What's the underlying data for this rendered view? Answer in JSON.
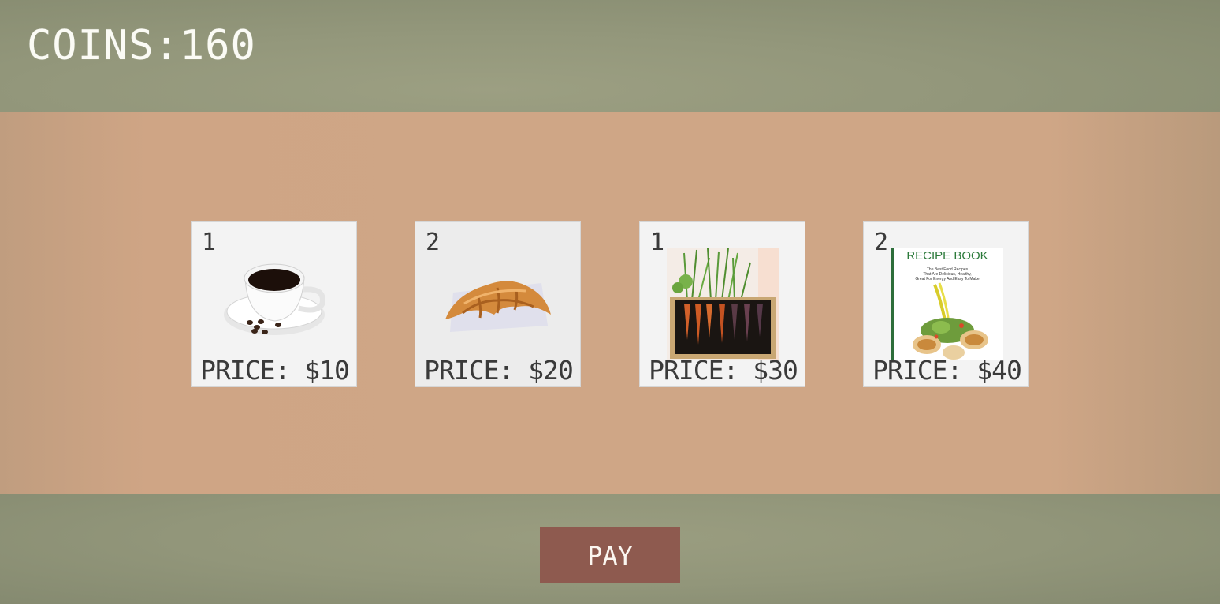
{
  "hud": {
    "coins_text": "COINS:160"
  },
  "shop": {
    "items": [
      {
        "quantity": "1",
        "price_text": "PRICE: $10",
        "icon": "coffee-cup-icon"
      },
      {
        "quantity": "2",
        "price_text": "PRICE: $20",
        "icon": "croissant-icon"
      },
      {
        "quantity": "1",
        "price_text": "PRICE: $30",
        "icon": "carrot-planter-icon"
      },
      {
        "quantity": "2",
        "price_text": "PRICE: $40",
        "icon": "recipe-book-icon",
        "cover_title": "RECIPE BOOK",
        "cover_subtitle_lines": [
          "The Best Food Recipes",
          "That Are Delicious, Healthy,",
          "Great For Energy And Easy To Make"
        ]
      }
    ]
  },
  "actions": {
    "pay_label": "PAY"
  },
  "colors": {
    "top_band": "#93977b",
    "middle_band": "#cfa686",
    "bottom_band": "#92967a",
    "pay_button": "#8e5a4f",
    "card_bg": "#f3f3f3"
  }
}
